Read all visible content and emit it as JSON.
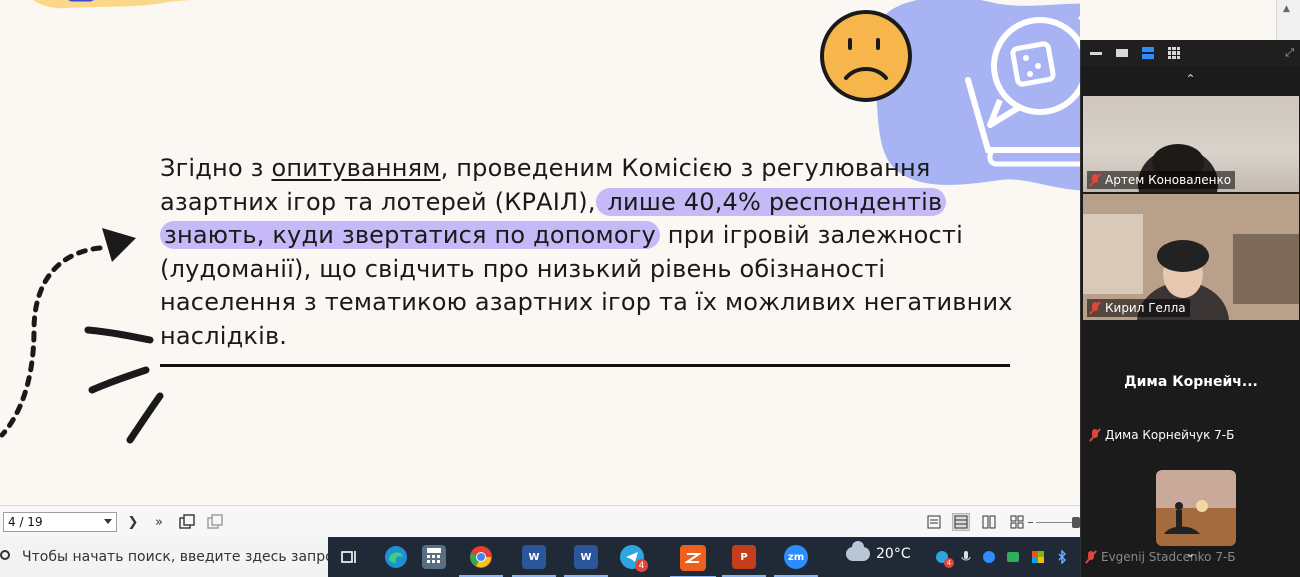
{
  "slide": {
    "text_intro": "Згідно з ",
    "text_underlined": "опитуванням",
    "text_mid": ", проведеним Комісією з регулювання азартних ігор та лотерей (КРАІЛ),",
    "text_highlight": " лише 40,4% респондентів знають, куди звертатися по допомогу",
    "text_end": " при ігровій залежності (лудоманії), що свідчить про низький рівень обізнаності населення з тематикою азартних ігор та їх можливих негативних наслідків.",
    "colors": {
      "background": "#fbf8f3",
      "highlight": "#c5b9f7",
      "blob": "#a7b3f2",
      "face": "#f6b64c"
    }
  },
  "pdf_toolbar": {
    "page_indicator": "4 / 19"
  },
  "zoom_panel": {
    "participants": [
      {
        "name": "Артем Коноваленко",
        "muted": true
      },
      {
        "name": "Кирил Гелла",
        "muted": true
      },
      {
        "name": "Дима Корнейчук 7-Б",
        "display_name": "Дима  Корнейч...",
        "muted": true
      },
      {
        "name": "Evgenij Stadcenko 7-Б",
        "muted": true
      }
    ]
  },
  "taskbar": {
    "search_placeholder": "Чтобы начать поиск, введите здесь запрос",
    "weather": "20°C",
    "telegram_badge": "4",
    "tray_badge": "4",
    "icons": [
      "task-view-icon",
      "edge-icon",
      "calculator-icon",
      "chrome-icon",
      "word-icon",
      "word-icon-2",
      "telegram-icon",
      "pdf-reader-icon",
      "powerpoint-icon",
      "zoom-icon"
    ]
  }
}
